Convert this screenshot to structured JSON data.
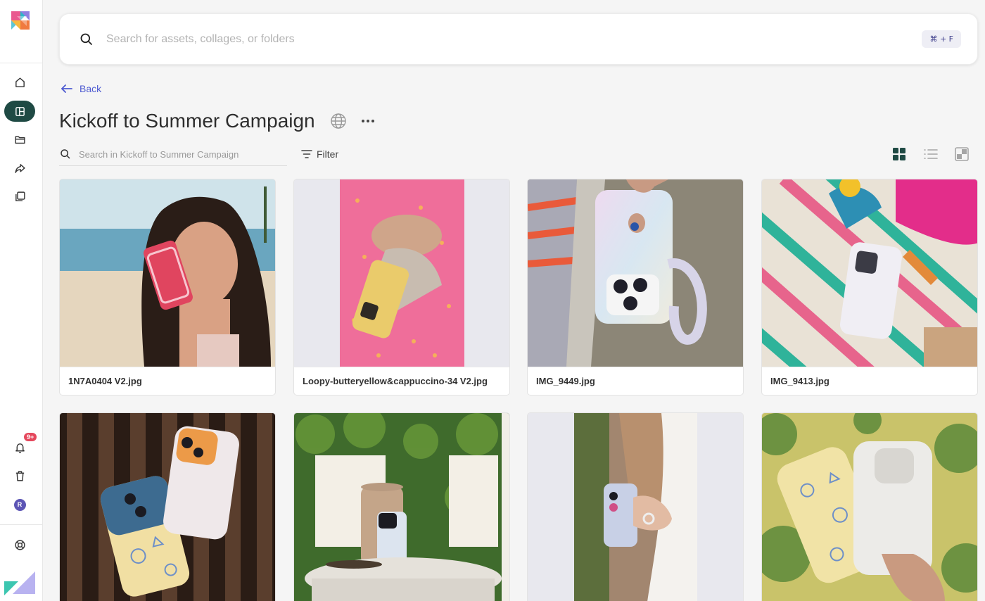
{
  "sidebar": {
    "notifications_badge": "9+",
    "avatar_letter": "R"
  },
  "top_search": {
    "placeholder": "Search for assets, collages, or folders",
    "shortcut": "⌘ + F"
  },
  "nav": {
    "back_label": "Back"
  },
  "page": {
    "title": "Kickoff to Summer Campaign"
  },
  "inner_search": {
    "placeholder": "Search in Kickoff to Summer Campaign"
  },
  "toolbar": {
    "filter_label": "Filter",
    "active_view": "grid"
  },
  "assets": [
    {
      "name": "1N7A0404 V2.jpg"
    },
    {
      "name": "Loopy-butteryellow&cappuccino-34 V2.jpg"
    },
    {
      "name": "IMG_9449.jpg"
    },
    {
      "name": "IMG_9413.jpg"
    },
    {
      "name": ""
    },
    {
      "name": ""
    },
    {
      "name": ""
    },
    {
      "name": ""
    }
  ],
  "colors": {
    "accent": "#4e5bd1",
    "sidebar_active": "#1f4a44",
    "badge": "#e5485d"
  }
}
